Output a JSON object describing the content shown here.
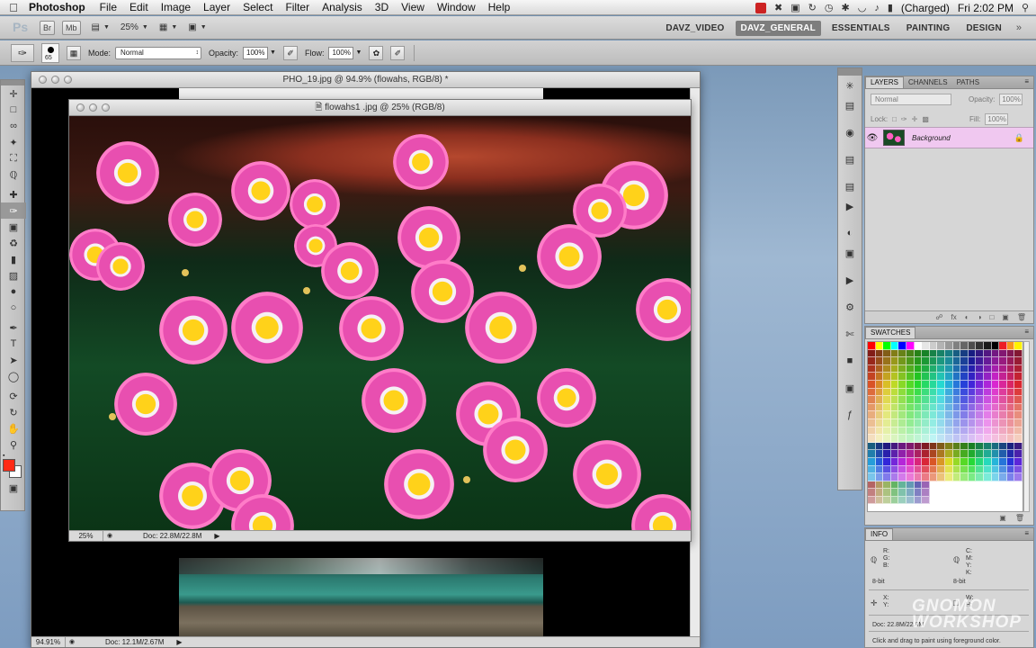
{
  "menubar": {
    "apple_icon": "apple-icon",
    "app_name": "Photoshop",
    "items": [
      "File",
      "Edit",
      "Image",
      "Layer",
      "Select",
      "Filter",
      "Analysis",
      "3D",
      "View",
      "Window",
      "Help"
    ],
    "battery": "(Charged)",
    "clock": "Fri 2:02 PM"
  },
  "appbar": {
    "logo": "Ps",
    "br_label": "Br",
    "mb_label": "Mb",
    "zoom": "25%",
    "workspaces": [
      "DAVZ_VIDEO",
      "DAVZ_GENERAL",
      "ESSENTIALS",
      "PAINTING",
      "DESIGN"
    ],
    "active_workspace": "DAVZ_GENERAL",
    "more": "»"
  },
  "options": {
    "brush_size": "65",
    "mode_label": "Mode:",
    "mode_value": "Normal",
    "opacity_label": "Opacity:",
    "opacity_value": "100%",
    "flow_label": "Flow:",
    "flow_value": "100%"
  },
  "docs": {
    "pho": {
      "title": "PHO_19.jpg @ 94.9% (flowahs, RGB/8) *",
      "zoom": "94.91%",
      "info": "Doc: 12.1M/2.67M"
    },
    "flow": {
      "title": "flowahs1 .jpg @ 25% (RGB/8)",
      "zoom": "25%",
      "info": "Doc: 22.8M/22.8M"
    }
  },
  "layers_panel": {
    "tabs": [
      "LAYERS",
      "CHANNELS",
      "PATHS"
    ],
    "blend_mode": "Normal",
    "opacity_label": "Opacity:",
    "opacity_value": "100%",
    "lock_label": "Lock:",
    "fill_label": "Fill:",
    "fill_value": "100%",
    "layer_name": "Background",
    "menu": "≡"
  },
  "swatches_panel": {
    "title": "SWATCHES"
  },
  "info_panel": {
    "title": "INFO",
    "r": "R:",
    "g": "G:",
    "b": "B:",
    "c": "C:",
    "m": "M:",
    "y": "Y:",
    "k": "K:",
    "bits_left": "8-bit",
    "bits_right": "8-bit",
    "x": "X:",
    "yy": "Y:",
    "w": "W:",
    "h": "H:",
    "doc": "Doc: 22.8M/22.8M",
    "hint": "Click and drag to paint using foreground color.",
    "watermark": "GNOMON WORKSHOP"
  },
  "colors": {
    "foreground": "#ff2a15",
    "background": "#ffffff",
    "layer_highlight": "#f0c8f0"
  }
}
